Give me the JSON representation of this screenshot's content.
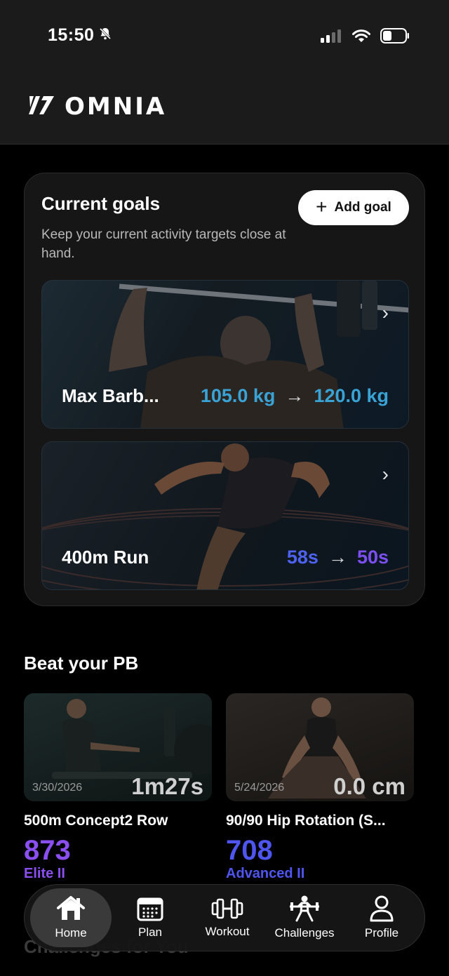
{
  "status": {
    "time": "15:50"
  },
  "header": {
    "brand": "OMNIA"
  },
  "goals": {
    "title": "Current goals",
    "subtitle": "Keep your current activity targets close at hand.",
    "add_label": "Add goal",
    "items": [
      {
        "name": "Max Barb...",
        "from": "105.0 kg",
        "to": "120.0 kg",
        "from_color": "#3aa3d6",
        "to_color": "#3aa3d6"
      },
      {
        "name": "400m Run",
        "from": "58s",
        "to": "50s",
        "from_color": "#4e62f0",
        "to_color": "#7b4ff0"
      }
    ]
  },
  "pb": {
    "title": "Beat your PB",
    "cards": [
      {
        "date": "3/30/2026",
        "result": "1m27s",
        "name": "500m Concept2 Row",
        "score": "873",
        "level": "Elite II"
      },
      {
        "date": "5/24/2026",
        "result": "0.0 cm",
        "name": "90/90 Hip Rotation (S...",
        "score": "708",
        "level": "Advanced II"
      }
    ]
  },
  "next_section": "Challenges for You",
  "nav": {
    "items": [
      {
        "label": "Home",
        "icon": "home-icon"
      },
      {
        "label": "Plan",
        "icon": "calendar-icon"
      },
      {
        "label": "Workout",
        "icon": "dumbbell-icon"
      },
      {
        "label": "Challenges",
        "icon": "weightlifter-icon"
      },
      {
        "label": "Profile",
        "icon": "person-icon"
      }
    ]
  }
}
